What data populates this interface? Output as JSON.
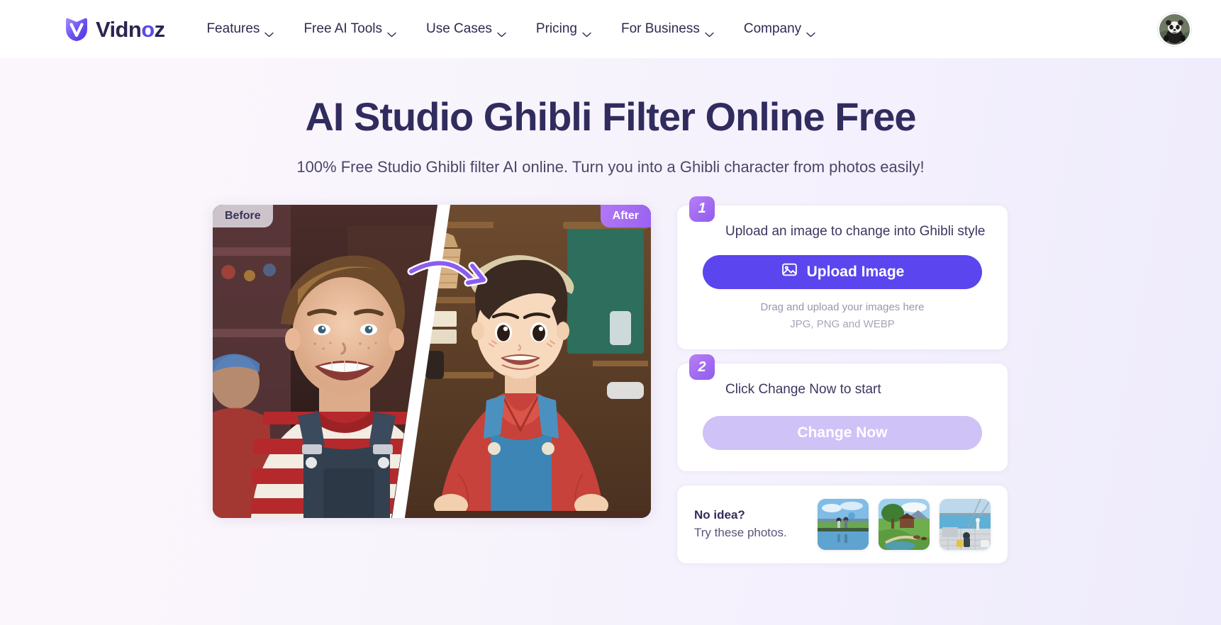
{
  "brand": {
    "name_prefix": "Vidn",
    "name_accent": "o",
    "name_suffix": "z",
    "full_name": "Vidnoz",
    "logo_icon": "vidnoz-v-logo-icon",
    "accent_color": "#5b45ee"
  },
  "nav": {
    "items": [
      {
        "label": "Features",
        "icon": "chevron-down-icon"
      },
      {
        "label": "Free AI Tools",
        "icon": "chevron-down-icon"
      },
      {
        "label": "Use Cases",
        "icon": "chevron-down-icon"
      },
      {
        "label": "Pricing",
        "icon": "chevron-down-icon"
      },
      {
        "label": "For Business",
        "icon": "chevron-down-icon"
      },
      {
        "label": "Company",
        "icon": "chevron-down-icon"
      }
    ],
    "avatar_icon": "panda-avatar"
  },
  "hero": {
    "title": "AI Studio Ghibli Filter Online Free",
    "subtitle": "100% Free Studio Ghibli filter AI online. Turn you into a Ghibli character from photos easily!"
  },
  "preview": {
    "before_label": "Before",
    "after_label": "After",
    "arrow_icon": "curved-arrow-icon",
    "before_alt": "photo of smiling boy in red striped shirt and denim overalls",
    "after_alt": "ghibli style anime boy in red kimono with blue apron"
  },
  "steps": [
    {
      "number": "1",
      "heading": "Upload an image to change into Ghibli style",
      "button_label": "Upload Image",
      "button_icon": "image-upload-icon",
      "hint_line1": "Drag and upload your images here",
      "hint_line2": "JPG, PNG and WEBP"
    },
    {
      "number": "2",
      "heading": "Click Change Now to start",
      "button_label": "Change Now",
      "button_disabled": true
    }
  ],
  "suggestions": {
    "title": "No idea?",
    "subtitle": "Try these photos.",
    "thumbs": [
      {
        "name": "lake-reflection-thumb",
        "alt": "two people walking by a lake with reflection"
      },
      {
        "name": "countryside-farm-thumb",
        "alt": "green countryside with tree, house and pond"
      },
      {
        "name": "seaside-pier-thumb",
        "alt": "person sitting at a seaside pier"
      }
    ]
  }
}
